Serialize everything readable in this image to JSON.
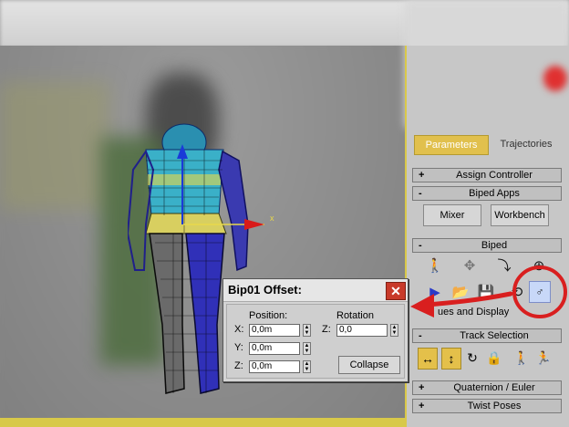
{
  "panel": {
    "tabs": [
      {
        "label": "Parameters",
        "active": true
      },
      {
        "label": "Trajectories",
        "active": false
      }
    ],
    "rollouts": {
      "assign_controller": {
        "sign": "+",
        "title": "Assign Controller"
      },
      "biped_apps": {
        "sign": "-",
        "title": "Biped Apps"
      },
      "biped": {
        "sign": "-",
        "title": "Biped"
      },
      "track_selection": {
        "sign": "-",
        "title": "Track Selection"
      },
      "quaternion_euler": {
        "sign": "+",
        "title": "Quaternion / Euler"
      },
      "twist_poses": {
        "sign": "+",
        "title": "Twist Poses"
      }
    },
    "biped_apps_buttons": {
      "mixer": "Mixer",
      "workbench": "Workbench"
    },
    "modes_display_label": "ues and Display",
    "accent_color": "#e1c04d"
  },
  "dialog": {
    "title": "Bip01 Offset:",
    "close_glyph": "✕",
    "position_label": "Position:",
    "rotation_label": "Rotation",
    "x_label": "X:",
    "y_label": "Y:",
    "z_label": "Z:",
    "x_value": "0,0m",
    "y_value": "0,0m",
    "z_value": "0,0m",
    "rot_z_label": "Z:",
    "rot_z_value": "0,0",
    "collapse_label": "Collapse"
  },
  "viewport": {
    "axis_x_label": "x"
  },
  "annotations": {
    "arrow_color": "#d91f1f",
    "circle_color": "#d91f1f"
  }
}
